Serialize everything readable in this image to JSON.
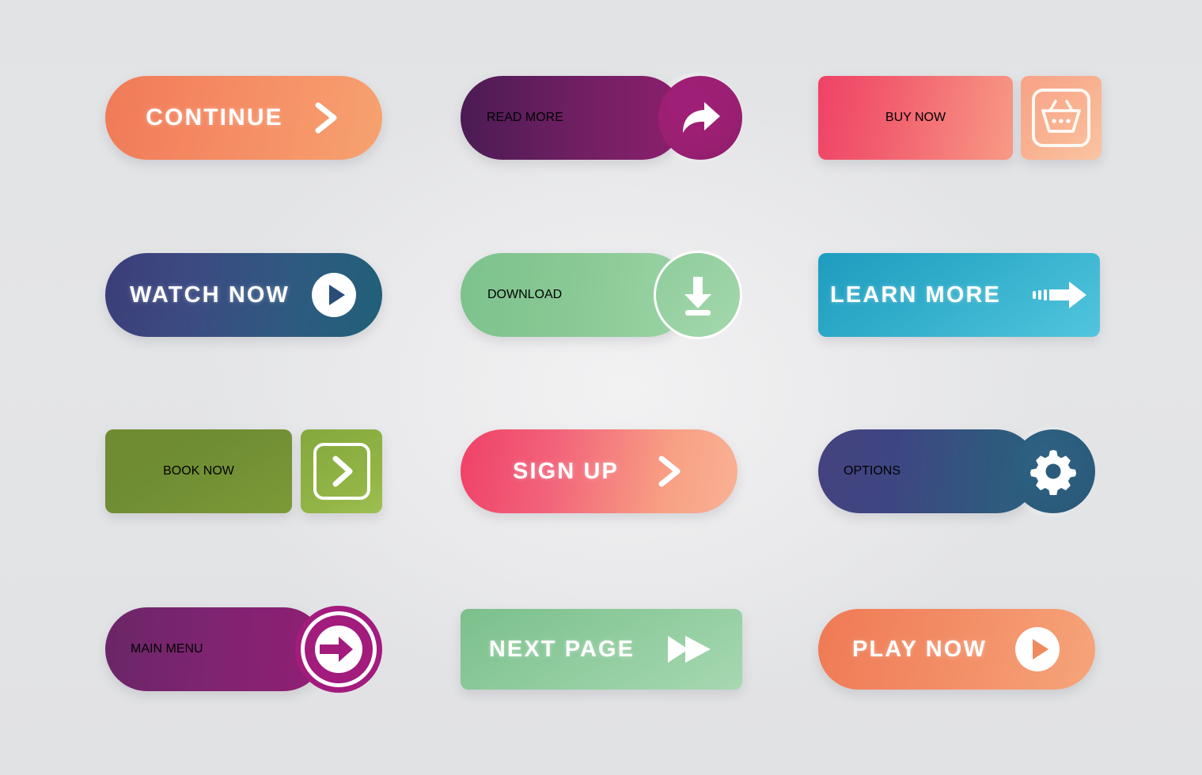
{
  "page": {
    "title": "Modern Gradient Call-To-Action Button Set",
    "background_color": "#e3e4e6"
  },
  "buttons": [
    {
      "id": "continue",
      "label": "CONTINUE",
      "icon": "chevron-right-icon",
      "shape": "pill",
      "gradient_from": "#f07a57",
      "gradient_to": "#f6a26f",
      "text_color": "#ffffff",
      "row": 1,
      "col": 1
    },
    {
      "id": "read-more",
      "label": "READ MORE",
      "icon": "share-arrow-icon",
      "shape": "pill-with-circle",
      "gradient_from": "#4b1b54",
      "gradient_to": "#8d1f6d",
      "badge_color": "#9a1f72",
      "text_color": "#ffffff",
      "row": 1,
      "col": 2
    },
    {
      "id": "buy-now",
      "label": "BUY NOW",
      "icon": "shopping-basket-icon",
      "shape": "rect-with-square",
      "gradient_from": "#ef4266",
      "gradient_to": "#f89a85",
      "badge_color": "#f9b392",
      "text_color": "#ffffff",
      "row": 1,
      "col": 3
    },
    {
      "id": "watch-now",
      "label": "WATCH NOW",
      "icon": "play-circle-icon",
      "shape": "pill",
      "gradient_from": "#3b3d78",
      "gradient_to": "#206077",
      "text_color": "#ffffff",
      "row": 2,
      "col": 1
    },
    {
      "id": "download",
      "label": "DOWNLOAD",
      "icon": "download-circle-icon",
      "shape": "pill-with-circle",
      "gradient_from": "#7dc28d",
      "gradient_to": "#9bd3a5",
      "text_color": "#ffffff",
      "row": 2,
      "col": 2
    },
    {
      "id": "learn-more",
      "label": "LEARN MORE",
      "icon": "arrow-right-motion-icon",
      "shape": "rounded-rect",
      "gradient_from": "#1e9cbf",
      "gradient_to": "#52c5de",
      "text_color": "#ffffff",
      "row": 2,
      "col": 3
    },
    {
      "id": "book-now",
      "label": "BOOK NOW",
      "icon": "chevron-right-box-icon",
      "shape": "rect-with-square",
      "gradient_from": "#6f8b32",
      "gradient_to": "#7d9a38",
      "badge_color": "#93b546",
      "text_color": "#ffffff",
      "row": 3,
      "col": 1
    },
    {
      "id": "sign-up",
      "label": "SIGN UP",
      "icon": "chevron-right-icon",
      "shape": "pill",
      "gradient_from": "#ef4166",
      "gradient_to": "#f9b195",
      "text_color": "#ffffff",
      "row": 3,
      "col": 2
    },
    {
      "id": "options",
      "label": "OPTIONS",
      "icon": "gear-icon",
      "shape": "pill-with-circle",
      "gradient_from": "#44427f",
      "gradient_to": "#2a5e7c",
      "badge_color": "#2b5b7b",
      "text_color": "#ffffff",
      "row": 3,
      "col": 3
    },
    {
      "id": "main-menu",
      "label": "MAIN MENU",
      "icon": "enter-arrow-circle-icon",
      "shape": "pill-with-circle",
      "gradient_from": "#6a2667",
      "gradient_to": "#921e73",
      "badge_color": "#a31b7d",
      "text_color": "#ffffff",
      "row": 4,
      "col": 1
    },
    {
      "id": "next-page",
      "label": "NEXT PAGE",
      "icon": "fast-forward-icon",
      "shape": "rounded-rect",
      "gradient_from": "#7bc08c",
      "gradient_to": "#a7d8b1",
      "text_color": "#ffffff",
      "row": 4,
      "col": 2
    },
    {
      "id": "play-now",
      "label": "PLAY NOW",
      "icon": "play-circle-icon",
      "shape": "pill",
      "gradient_from": "#ef7a55",
      "gradient_to": "#f6a47a",
      "text_color": "#ffffff",
      "row": 4,
      "col": 3
    }
  ]
}
